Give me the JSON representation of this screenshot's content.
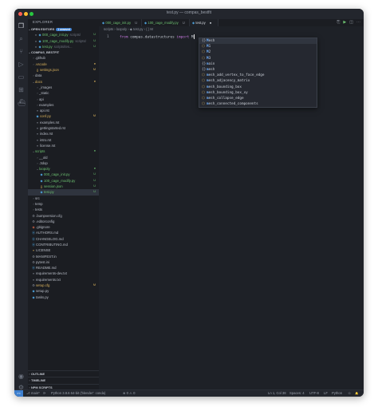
{
  "window": {
    "title": "test.py — compas_bestfit"
  },
  "activity_icons": [
    "files-icon",
    "search-icon",
    "source-control-icon",
    "run-debug-icon",
    "remote-icon",
    "extensions-icon",
    "docker-icon"
  ],
  "activity_bottom": [
    "account-icon",
    "settings-gear-icon"
  ],
  "sidebar": {
    "header": "EXPLORER",
    "open_editors": {
      "label": "OPEN EDITORS",
      "badge": "1 unsaved"
    },
    "open_files": [
      {
        "name": "000_cage_init.py",
        "path": "scripts/",
        "status": "U"
      },
      {
        "name": "100_cage_modify.py",
        "path": "scripts/",
        "status": "U"
      },
      {
        "name": "test.py",
        "path": "scripts/tes...",
        "status": "U"
      }
    ],
    "project": "COMPAS_BESTFIT",
    "tree": [
      {
        "name": ".github",
        "indent": 1,
        "type": "folder"
      },
      {
        "name": ".vscode",
        "indent": 1,
        "type": "folder",
        "status": "●",
        "status_color": "#d7b05c",
        "color": "#d7b05c"
      },
      {
        "name": "settings.json",
        "indent": 2,
        "type": "json",
        "status": "M",
        "status_color": "#d7b05c",
        "color": "#d7b05c"
      },
      {
        "name": "data",
        "indent": 1,
        "type": "folder"
      },
      {
        "name": "docs",
        "indent": 1,
        "type": "folder-open",
        "status": "●",
        "status_color": "#d7b05c",
        "color": "#d7b05c"
      },
      {
        "name": "_images",
        "indent": 2,
        "type": "folder"
      },
      {
        "name": "_static",
        "indent": 2,
        "type": "folder"
      },
      {
        "name": "api",
        "indent": 2,
        "type": "folder"
      },
      {
        "name": "examples",
        "indent": 2,
        "type": "folder"
      },
      {
        "name": "api.rst",
        "indent": 2,
        "type": "rst"
      },
      {
        "name": "conf.py",
        "indent": 2,
        "type": "py",
        "status": "M",
        "status_color": "#d7b05c",
        "color": "#d7b05c"
      },
      {
        "name": "examples.rst",
        "indent": 2,
        "type": "rst"
      },
      {
        "name": "gettingstarted.rst",
        "indent": 2,
        "type": "rst"
      },
      {
        "name": "index.rst",
        "indent": 2,
        "type": "rst"
      },
      {
        "name": "intro.rst",
        "indent": 2,
        "type": "rst"
      },
      {
        "name": "license.rst",
        "indent": 2,
        "type": "rst"
      },
      {
        "name": "scripts",
        "indent": 1,
        "type": "folder-open",
        "status": "●",
        "status_color": "#6cc070",
        "color": "#6cc070"
      },
      {
        "name": "__old",
        "indent": 2,
        "type": "folder"
      },
      {
        "name": ".3dop",
        "indent": 2,
        "type": "folder"
      },
      {
        "name": "loopoly",
        "indent": 2,
        "type": "folder-open",
        "status": "●",
        "status_color": "#6cc070",
        "color": "#6cc070"
      },
      {
        "name": "000_cage_init.py",
        "indent": 3,
        "type": "py",
        "status": "U",
        "status_color": "#6cc070",
        "color": "#6cc070"
      },
      {
        "name": "100_cage_modify.py",
        "indent": 3,
        "type": "py",
        "status": "U",
        "status_color": "#6cc070",
        "color": "#6cc070"
      },
      {
        "name": "session.json",
        "indent": 3,
        "type": "json",
        "status": "U",
        "status_color": "#6cc070",
        "color": "#6cc070"
      },
      {
        "name": "test.py",
        "indent": 3,
        "type": "py",
        "status": "U",
        "status_color": "#6cc070",
        "color": "#6cc070",
        "selected": true
      },
      {
        "name": "src",
        "indent": 1,
        "type": "folder"
      },
      {
        "name": "temp",
        "indent": 1,
        "type": "folder"
      },
      {
        "name": "tests",
        "indent": 1,
        "type": "folder"
      },
      {
        "name": ".bumpversion.cfg",
        "indent": 1,
        "type": "cfg"
      },
      {
        "name": ".editorconfig",
        "indent": 1,
        "type": "cfg"
      },
      {
        "name": ".gitignore",
        "indent": 1,
        "type": "git"
      },
      {
        "name": "AUTHORS.md",
        "indent": 1,
        "type": "md"
      },
      {
        "name": "CHANGELOG.md",
        "indent": 1,
        "type": "md"
      },
      {
        "name": "CONTRIBUTING.md",
        "indent": 1,
        "type": "md"
      },
      {
        "name": "LICENSE",
        "indent": 1,
        "type": "lic"
      },
      {
        "name": "MANIFEST.in",
        "indent": 1,
        "type": "cfg"
      },
      {
        "name": "pytest.ini",
        "indent": 1,
        "type": "cfg"
      },
      {
        "name": "README.md",
        "indent": 1,
        "type": "md"
      },
      {
        "name": "requirements-dev.txt",
        "indent": 1,
        "type": "txt"
      },
      {
        "name": "requirements.txt",
        "indent": 1,
        "type": "txt"
      },
      {
        "name": "setup.cfg",
        "indent": 1,
        "type": "cfg",
        "status": "M",
        "status_color": "#d7b05c",
        "color": "#d7b05c"
      },
      {
        "name": "setup.py",
        "indent": 1,
        "type": "py"
      },
      {
        "name": "tasks.py",
        "indent": 1,
        "type": "py"
      }
    ],
    "bottom_sections": [
      "OUTLINE",
      "TIMELINE",
      "NPM SCRIPTS"
    ]
  },
  "tabs": [
    {
      "label": "000_cage_init.py",
      "status": "U",
      "active": false
    },
    {
      "label": "100_cage_modify.py",
      "status": "U",
      "active": false
    },
    {
      "label": "test.py",
      "status": "●",
      "active": true
    }
  ],
  "tab_actions": [
    "⎘",
    "▶",
    "◫",
    "⋯"
  ],
  "breadcrumbs": "scripts  ›  loopoly  ›  ◆ test.py  ›  { } M",
  "editor": {
    "line_number": "1",
    "tokens": [
      {
        "text": "from ",
        "color": "#c678dd"
      },
      {
        "text": "compas.datastructures ",
        "color": "#c9ced6"
      },
      {
        "text": "import ",
        "color": "#c678dd"
      },
      {
        "text": "M",
        "color": "#c9ced6"
      }
    ]
  },
  "suggestions": [
    {
      "icon": "{}",
      "kind": "mod",
      "label": "Mesh",
      "selected": true
    },
    {
      "icon": "⬡",
      "kind": "var",
      "label": "M1"
    },
    {
      "icon": "⬡",
      "kind": "var",
      "label": "M2"
    },
    {
      "icon": "⬡",
      "kind": "var",
      "label": "M3"
    },
    {
      "icon": "{}",
      "kind": "mod",
      "label": "main"
    },
    {
      "icon": "{}",
      "kind": "mod",
      "label": "mesh"
    },
    {
      "icon": "⬡",
      "kind": "var",
      "label": "mesh_add_vertex_to_face_edge"
    },
    {
      "icon": "⬡",
      "kind": "var",
      "label": "mesh_adjacency_matrix"
    },
    {
      "icon": "⬡",
      "kind": "var",
      "label": "mesh_bounding_box"
    },
    {
      "icon": "⬡",
      "kind": "var",
      "label": "mesh_bounding_box_xy"
    },
    {
      "icon": "⬡",
      "kind": "var",
      "label": "mesh_collapse_edge"
    },
    {
      "icon": "⬡",
      "kind": "var",
      "label": "mesh_connected_components"
    }
  ],
  "status": {
    "remote": "><",
    "branch": "⎇ main*",
    "sync": "⟳",
    "errors": "⊗ 0 ⚠ 0",
    "interpreter": "Python 3.8.6 64-bit ('blender': conda)",
    "position": "Ln 1, Col 38",
    "spaces": "Spaces: 4",
    "encoding": "UTF-8",
    "eol": "LF",
    "language": "Python",
    "feedback": "☺",
    "bell": "🔔"
  }
}
